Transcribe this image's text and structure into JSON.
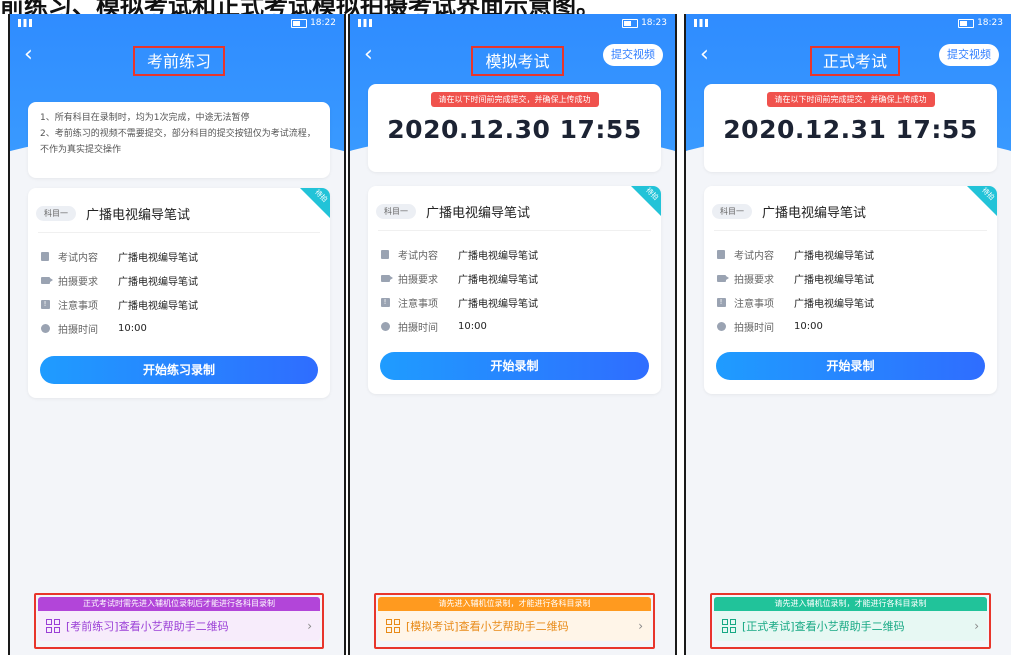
{
  "doc_caption": "前练习、模拟考试和正式考试模拟拍摄考试界面示意图。",
  "shared": {
    "back_glyph": "‹",
    "subject_pill": "科目一",
    "subject_name": "广播电视编导笔试",
    "corner_tag": "待拍",
    "chevron": "›",
    "info_rows": [
      {
        "icon": "document-icon",
        "label": "考试内容",
        "value": "广播电视编导笔试"
      },
      {
        "icon": "camera-icon",
        "label": "拍摄要求",
        "value": "广播电视编导笔试"
      },
      {
        "icon": "notice-icon",
        "label": "注意事项",
        "value": "广播电视编导笔试"
      },
      {
        "icon": "clock-icon",
        "label": "拍摄时间",
        "value": "10:00"
      }
    ]
  },
  "screens": [
    {
      "status_time": "18:22",
      "title": "考前练习",
      "notice_lines": [
        "1、所有科目在录制时，均为1次完成，中途无法暂停",
        "2、考前练习的视频不需要提交，部分科目的提交按钮仅为考试流程，不作为真实提交操作"
      ],
      "start_button": "开始练习录制",
      "banner": "正式考试时需先进入辅机位录制后才能进行各科目录制",
      "helper_link": "[考前练习]查看小艺帮助手二维码",
      "banner_color": "#b245d9"
    },
    {
      "status_time": "18:23",
      "title": "模拟考试",
      "submit_button": "提交视频",
      "deadline_tag": "请在以下时间前完成提交，并确保上传成功",
      "deadline_time": "2020.12.30 17:55",
      "start_button": "开始录制",
      "banner": "请先进入辅机位录制，才能进行各科目录制",
      "helper_link": "[模拟考试]查看小艺帮助手二维码",
      "banner_color": "#ff9a1f"
    },
    {
      "status_time": "18:23",
      "title": "正式考试",
      "submit_button": "提交视频",
      "deadline_tag": "请在以下时间前完成提交，并确保上传成功",
      "deadline_time": "2020.12.31 17:55",
      "start_button": "开始录制",
      "banner": "请先进入辅机位录制，才能进行各科目录制",
      "helper_link": "[正式考试]查看小艺帮助手二维码",
      "banner_color": "#21c39a"
    }
  ]
}
